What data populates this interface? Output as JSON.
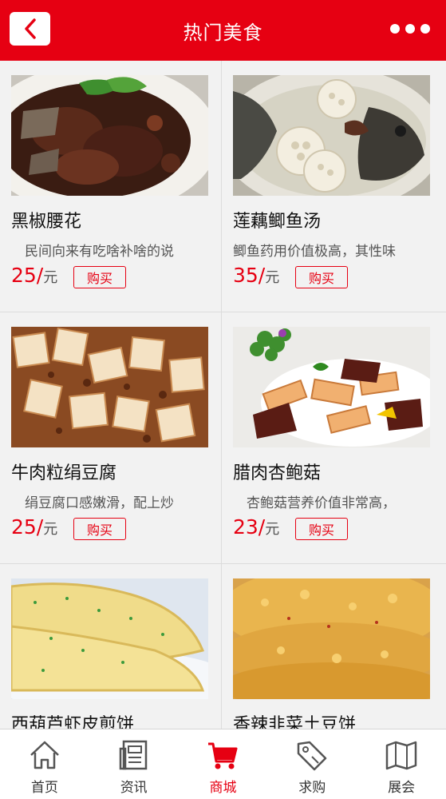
{
  "header": {
    "title": "热门美食",
    "back_icon": "chevron-left-icon",
    "more_icon": "more-dots-icon"
  },
  "products": [
    {
      "name": "黑椒腰花",
      "desc": "民间向来有吃啥补啥的说",
      "price": "25/",
      "unit": "元",
      "buy": "购买"
    },
    {
      "name": "莲藕鲫鱼汤",
      "desc": "鲫鱼药用价值极高，其性味",
      "price": "35/",
      "unit": "元",
      "buy": "购买"
    },
    {
      "name": "牛肉粒绢豆腐",
      "desc": "绢豆腐口感嫩滑，配上炒",
      "price": "25/",
      "unit": "元",
      "buy": "购买"
    },
    {
      "name": "腊肉杏鲍菇",
      "desc": "杏鲍菇营养价值非常高，",
      "price": "23/",
      "unit": "元",
      "buy": "购买"
    },
    {
      "name": "西葫芦虾皮煎饼",
      "desc": "",
      "price": "",
      "unit": "",
      "buy": ""
    },
    {
      "name": "香辣韭菜土豆饼",
      "desc": "",
      "price": "",
      "unit": "",
      "buy": ""
    }
  ],
  "tabbar": {
    "active": "商城",
    "items": [
      {
        "label": "首页",
        "icon": "home-icon"
      },
      {
        "label": "资讯",
        "icon": "news-icon"
      },
      {
        "label": "商城",
        "icon": "cart-icon"
      },
      {
        "label": "求购",
        "icon": "tag-icon"
      },
      {
        "label": "展会",
        "icon": "map-icon"
      }
    ]
  },
  "colors": {
    "brand": "#e60012",
    "background": "#f2f2f2"
  }
}
